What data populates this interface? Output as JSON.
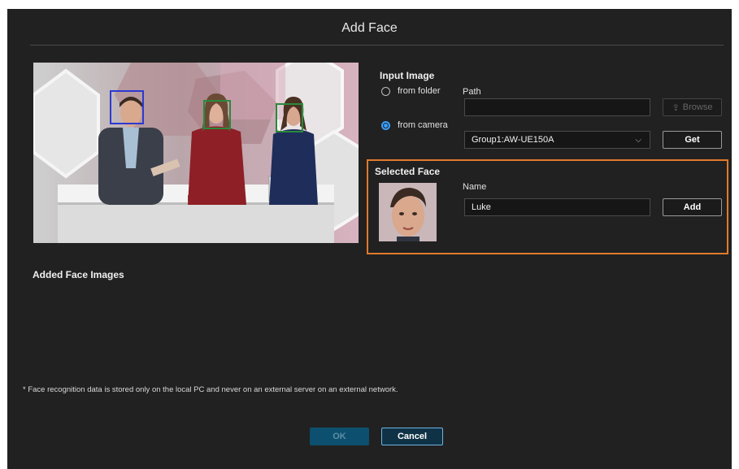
{
  "dialog": {
    "title": "Add Face",
    "note": "* Face recognition data is stored only on the local PC and never on an external server on an external network.",
    "ok_label": "OK",
    "cancel_label": "Cancel"
  },
  "input_image": {
    "section_title": "Input Image",
    "from_folder_label": "from folder",
    "from_camera_label": "from camera",
    "selected_source": "from camera",
    "path_label": "Path",
    "path_value": "",
    "browse_label": "Browse",
    "camera_value": "Group1:AW-UE150A",
    "get_label": "Get"
  },
  "selected_face": {
    "section_title": "Selected Face",
    "name_label": "Name",
    "name_value": "Luke",
    "add_label": "Add"
  },
  "added_faces": {
    "section_title": "Added Face Images"
  },
  "colors": {
    "dialog_bg": "#212121",
    "highlight_frame": "#e07a2c",
    "selected_face_box": "#2c3ad0",
    "detected_face_box": "#2a8a3c",
    "radio_active": "#3aa0ff",
    "ok_button_bg": "#0c4f6e"
  }
}
